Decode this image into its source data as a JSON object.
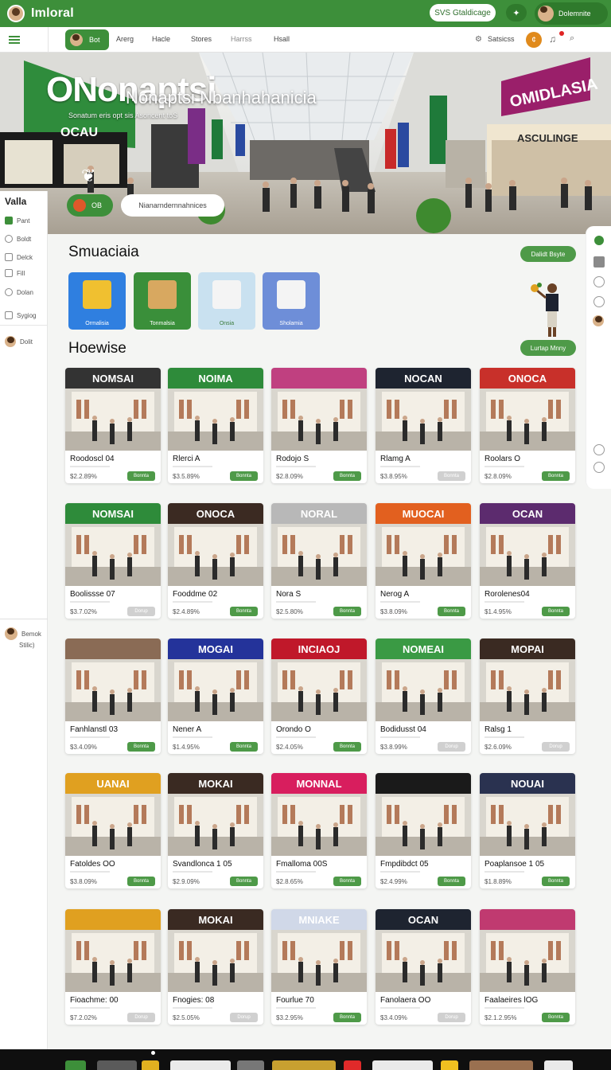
{
  "app": {
    "title": "Imloral",
    "topbar_button": "SVS Gtaldicage",
    "user_name": "Dolemnite"
  },
  "nav": {
    "active_label": "Bot",
    "links": [
      "Arerg",
      "Hacle",
      "Stores",
      "Harrss",
      "Hsall"
    ],
    "right_label": "Satsicss"
  },
  "hero": {
    "title": "Nonaptsi Nbanhahanicia",
    "subtitle": "Sonatum eris opt sis Asoncent toS",
    "badge_text": "OB",
    "cta_label": "Nianarndernnahnices",
    "left_sign": "ONonaptsi",
    "left_sign_sub": "OCAU",
    "right_sign": "OMIDLASIA",
    "right_sign_sub": "ASCULINGE"
  },
  "sidebar": {
    "title": "Valla",
    "items": [
      "Pant",
      "Boldt",
      "Delck",
      "Fill",
      "Dolan",
      "Sygiog"
    ],
    "user": "Dolit",
    "bottom_user": "Bemok",
    "bottom_user_sub": "Stilic)"
  },
  "categories": {
    "title": "Smuaciaia",
    "action": "Dalidt Bsyte",
    "items": [
      {
        "label": "Ormalisia",
        "color": "#2f7fe0"
      },
      {
        "label": "Tonmalsia",
        "color": "#3a8f3a"
      },
      {
        "label": "Onsia",
        "color": "#c9e1f0"
      },
      {
        "label": "Sholamia",
        "color": "#6e8ed8"
      }
    ]
  },
  "stores": {
    "title": "Hoewise",
    "action": "Lurtap Mnny",
    "rows": [
      [
        {
          "name": "Roodoscl 04",
          "price": "$2.2.89%",
          "button": "Bonnta",
          "active": true,
          "sign": "NOMSAI",
          "sign_color": "#333333"
        },
        {
          "name": "Rlerci A",
          "price": "$3.5.89%",
          "button": "Bonnta",
          "active": true,
          "sign": "NOIMA",
          "sign_color": "#2e8b3a"
        },
        {
          "name": "Rodojo S",
          "price": "$2.8.09%",
          "button": "Bonnta",
          "active": true,
          "sign": "",
          "sign_color": "#c04080"
        },
        {
          "name": "Rlamg A",
          "price": "$3.8.95%",
          "button": "Bonnta",
          "active": false,
          "sign": "NOCAN",
          "sign_color": "#1e2430"
        },
        {
          "name": "Roolars O",
          "price": "$2.8.09%",
          "button": "Bonnta",
          "active": true,
          "sign": "ONOCA",
          "sign_color": "#c8302a"
        }
      ],
      [
        {
          "name": "Boolissse 07",
          "price": "$3.7.02%",
          "button": "Dorup",
          "active": false,
          "sign": "NOMSAI",
          "sign_color": "#2e8b3a"
        },
        {
          "name": "Fooddme 02",
          "price": "$2.4.89%",
          "button": "Bonnta",
          "active": true,
          "sign": "ONOCA",
          "sign_color": "#3b2a22"
        },
        {
          "name": "Nora S",
          "price": "$2.5.80%",
          "button": "Bonnta",
          "active": true,
          "sign": "NORAL",
          "sign_color": "#b8b8b8"
        },
        {
          "name": "Nerog A",
          "price": "$3.8.09%",
          "button": "Bonnta",
          "active": true,
          "sign": "MUOCAI",
          "sign_color": "#e2601f"
        },
        {
          "name": "Rorolenes04",
          "price": "$1.4.95%",
          "button": "Bonnta",
          "active": true,
          "sign": "OCAN",
          "sign_color": "#5c2b6e"
        }
      ],
      [
        {
          "name": "Fanhlanstl 03",
          "price": "$3.4.09%",
          "button": "Bonnta",
          "active": true,
          "sign": "",
          "sign_color": "#8a6b55"
        },
        {
          "name": "Nener A",
          "price": "$1.4.95%",
          "button": "Bonnta",
          "active": true,
          "sign": "MOGAI",
          "sign_color": "#24339a"
        },
        {
          "name": "Orondo O",
          "price": "$2.4.05%",
          "button": "Bonnta",
          "active": true,
          "sign": "INCIAOJ",
          "sign_color": "#c0182a"
        },
        {
          "name": "Bodidusst 04",
          "price": "$3.8.99%",
          "button": "Dorup",
          "active": false,
          "sign": "NOMEAI",
          "sign_color": "#3a9a44"
        },
        {
          "name": "Ralsg 1",
          "price": "$2.6.09%",
          "button": "Dorup",
          "active": false,
          "sign": "MOPAI",
          "sign_color": "#3a2a22"
        }
      ],
      [
        {
          "name": "Fatoldes OO",
          "price": "$3.8.09%",
          "button": "Bonnta",
          "active": true,
          "sign": "UANAI",
          "sign_color": "#e0a020"
        },
        {
          "name": "Svandlonca 1 05",
          "price": "$2.9.09%",
          "button": "Bonnta",
          "active": true,
          "sign": "MOKAI",
          "sign_color": "#3a2a22"
        },
        {
          "name": "Fmalloma 00S",
          "price": "$2.8.65%",
          "button": "Bonnta",
          "active": true,
          "sign": "MONNAL",
          "sign_color": "#d81e5e"
        },
        {
          "name": "Fmpdibdct 05",
          "price": "$2.4.99%",
          "button": "Bonnta",
          "active": true,
          "sign": "",
          "sign_color": "#1a1a1a"
        },
        {
          "name": "Poaplansoe 1 05",
          "price": "$1.8.89%",
          "button": "Bonnta",
          "active": true,
          "sign": "NOUAI",
          "sign_color": "#2a3250"
        }
      ],
      [
        {
          "name": "Fioachme: 00",
          "price": "$7.2.02%",
          "button": "Dorup",
          "active": false,
          "sign": "",
          "sign_color": "#e0a020"
        },
        {
          "name": "Fnogies: 08",
          "price": "$2.5.05%",
          "button": "Dorup",
          "active": false,
          "sign": "MOKAI",
          "sign_color": "#3a2a22"
        },
        {
          "name": "Fourlue 70",
          "price": "$3.2.95%",
          "button": "Bonnta",
          "active": true,
          "sign": "MNIAKE",
          "sign_color": "#d0d8e8"
        },
        {
          "name": "Fanolaera OO",
          "price": "$3.4.09%",
          "button": "Dorup",
          "active": false,
          "sign": "OCAN",
          "sign_color": "#1e2430"
        },
        {
          "name": "Faalaeires lOG",
          "price": "$2.1.2.95%",
          "button": "Bonnta",
          "active": true,
          "sign": "",
          "sign_color": "#c03a70"
        }
      ]
    ]
  },
  "theme": {
    "accent": "#3d8f3a",
    "button_active": "#4e9a48",
    "button_inactive": "#d0d0d0"
  }
}
